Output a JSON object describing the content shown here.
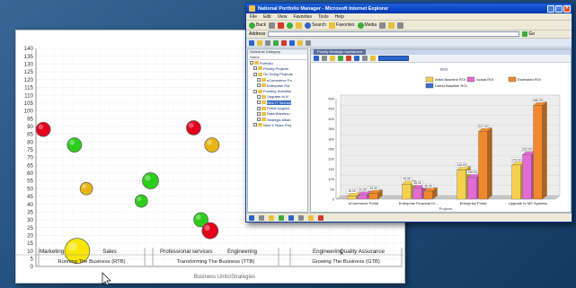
{
  "bubble_window": {
    "chart_data": {
      "type": "scatter",
      "ylim": [
        0,
        140
      ],
      "ytick_step": 5,
      "grid": true,
      "group_title": "Business Units\\Strategies",
      "categories": [
        "Marketing",
        "Sales",
        "Professional services",
        "Engineering",
        "Engineering",
        "Quality Assurance"
      ],
      "groups": [
        {
          "label": "Running The Business (RTB)",
          "categories": [
            "Marketing",
            "Sales"
          ]
        },
        {
          "label": "Transforming The Business (TTB)",
          "categories": [
            "Professional services",
            "Engineering"
          ]
        },
        {
          "label": "Growing The Business (GTB)",
          "categories": [
            "Engineering",
            "Quality Assurance"
          ]
        }
      ],
      "points": [
        {
          "x": 0.08,
          "y": 88,
          "r": 8,
          "color": "#e4001c"
        },
        {
          "x": 0.42,
          "y": 78,
          "r": 8,
          "color": "#2dcd1c"
        },
        {
          "x": 0.55,
          "y": 50,
          "r": 7,
          "color": "#e8b412"
        },
        {
          "x": 0.45,
          "y": 10,
          "r": 14,
          "color": "#f8e600"
        },
        {
          "x": 1.25,
          "y": 55,
          "r": 9,
          "color": "#2dcd1c"
        },
        {
          "x": 1.15,
          "y": 42,
          "r": 7,
          "color": "#2dcd1c"
        },
        {
          "x": 1.72,
          "y": 89,
          "r": 8,
          "color": "#e4001c"
        },
        {
          "x": 1.92,
          "y": 78,
          "r": 8,
          "color": "#e8b412"
        },
        {
          "x": 1.8,
          "y": 30,
          "r": 8,
          "color": "#2dcd1c"
        },
        {
          "x": 1.9,
          "y": 23,
          "r": 9,
          "color": "#e4001c"
        },
        {
          "x": 2.48,
          "y": 100,
          "r": 9,
          "color": "#e4001c"
        },
        {
          "x": 2.58,
          "y": 72,
          "r": 7,
          "color": "#f8e600"
        },
        {
          "x": 2.78,
          "y": 82,
          "r": 13,
          "color": "#2dcd1c"
        },
        {
          "x": 3.05,
          "y": 89,
          "r": 9,
          "color": "#e4001c"
        }
      ]
    }
  },
  "ie_window": {
    "title": "National Portfolio Manager - Microsoft Internet Explorer",
    "menu": [
      "File",
      "Edit",
      "View",
      "Favorites",
      "Tools",
      "Help"
    ],
    "toolbar": {
      "back": "Back",
      "search": "Search",
      "favorites": "Favorites",
      "media": "Media"
    },
    "address_label": "Address",
    "go_label": "Go",
    "active_tab": "Priority Strategic Investment",
    "left_pane_header": "Schedule Category",
    "left_pane_column": "Name",
    "tree": [
      {
        "label": "Portfolio",
        "level": 0,
        "selected": false
      },
      {
        "label": "Priority Projects",
        "level": 1,
        "selected": false
      },
      {
        "label": "On Going Projects",
        "level": 1,
        "selected": false
      },
      {
        "label": "eCommerce Po",
        "level": 2,
        "selected": false
      },
      {
        "label": "Enterprise Pla",
        "level": 2,
        "selected": false
      },
      {
        "label": "Funding Submiss",
        "level": 1,
        "selected": false
      },
      {
        "label": "Upgrade to N",
        "level": 2,
        "selected": false
      },
      {
        "label": "New IT Service",
        "level": 2,
        "selected": true
      },
      {
        "label": "Portal Upgrad",
        "level": 2,
        "selected": false
      },
      {
        "label": "Data Warehou",
        "level": 2,
        "selected": false
      },
      {
        "label": "Strategic Allian",
        "level": 2,
        "selected": false
      },
      {
        "label": "Next 5 Years Proj",
        "level": 1,
        "selected": false
      }
    ],
    "chart_data": {
      "type": "bar",
      "title": "ROI",
      "xlabel": "Projects",
      "ylim": [
        0,
        500
      ],
      "yticks": [
        0,
        50,
        100,
        150,
        200,
        250,
        300,
        350,
        400,
        450,
        500
      ],
      "categories": [
        "eCommerce Portal",
        "Enterprise Financial Di...",
        "Enterprise Portal",
        "Upgrade to MS Systems"
      ],
      "series": [
        {
          "name": "Initial Baseline ROI",
          "color": "#f6d04d",
          "values": [
            15.0,
            75.0,
            145.0,
            170.0
          ]
        },
        {
          "name": "Actual ROI",
          "color": "#e36bd3",
          "values": [
            22.0,
            55.0,
            108.0,
            222.0
          ]
        },
        {
          "name": "Estimated ROI",
          "color": "#f0892b",
          "values": [
            29.0,
            40.0,
            337.0,
            466.0
          ]
        },
        {
          "name": "Latest Baseline ROI",
          "color": "#3a6fd0",
          "values": [
            0,
            0,
            0,
            0
          ]
        }
      ],
      "data_labels": [
        [
          "15.00",
          "22.00",
          "29.00"
        ],
        [
          "75.00",
          "55.00",
          "40.00"
        ],
        [
          "145.00",
          "108.00",
          "337.00"
        ],
        [
          "170.00",
          "222.00",
          "466.00"
        ]
      ]
    }
  }
}
